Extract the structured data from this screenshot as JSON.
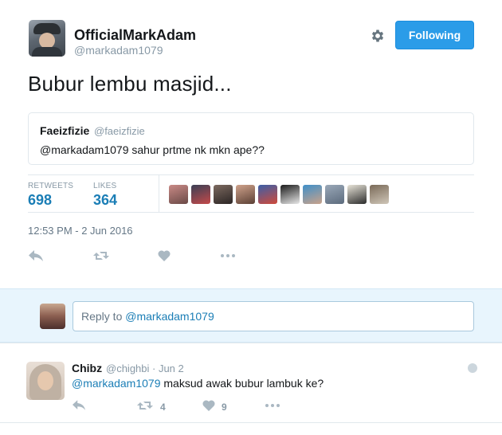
{
  "author": {
    "display_name": "OfficialMarkAdam",
    "username": "@markadam1079"
  },
  "follow_button_label": "Following",
  "tweet": {
    "text": "Bubur lembu masjid...",
    "timestamp": "12:53 PM - 2 Jun 2016"
  },
  "quoted_tweet": {
    "name": "Faeizfizie",
    "handle": "@faeizfizie",
    "text": "@markadam1079 sahur prtme nk mkn ape??"
  },
  "stats": {
    "retweets_label": "RETWEETS",
    "retweets_value": "698",
    "likes_label": "LIKES",
    "likes_value": "364"
  },
  "likers": [
    {
      "name": "liker-avatar-1",
      "colors": [
        "#c98a86",
        "#6b4a47"
      ]
    },
    {
      "name": "liker-avatar-2",
      "colors": [
        "#3a3f55",
        "#c44a4a"
      ]
    },
    {
      "name": "liker-avatar-3",
      "colors": [
        "#7d6a60",
        "#2b2524"
      ]
    },
    {
      "name": "liker-avatar-4",
      "colors": [
        "#d0a38c",
        "#5b4035"
      ]
    },
    {
      "name": "liker-avatar-5",
      "colors": [
        "#3b5fa8",
        "#d04a3a"
      ]
    },
    {
      "name": "liker-avatar-6",
      "colors": [
        "#1a1a1a",
        "#e8e8e8"
      ]
    },
    {
      "name": "liker-avatar-7",
      "colors": [
        "#3f8fc9",
        "#c9a28a"
      ]
    },
    {
      "name": "liker-avatar-8",
      "colors": [
        "#9aa8b8",
        "#5c6b7d"
      ]
    },
    {
      "name": "liker-avatar-9",
      "colors": [
        "#e8e4d8",
        "#2b2b2b"
      ]
    },
    {
      "name": "liker-avatar-10",
      "colors": [
        "#7a6a58",
        "#cfc6b8"
      ]
    }
  ],
  "reply_composer": {
    "prefix": "Reply to ",
    "mention": "@markadam1079"
  },
  "reply": {
    "name": "Chibz",
    "meta": "@chighbi · Jun 2",
    "mention": "@markadam1079",
    "text": " maksud awak bubur lambuk ke?",
    "retweet_count": "4",
    "like_count": "9"
  },
  "colors": {
    "accent": "#2b9ce8",
    "link": "#1b7eb6",
    "muted": "#8899a6",
    "reply_bg": "#e8f5fd"
  },
  "icons": [
    "gear-icon",
    "reply-icon",
    "retweet-icon",
    "heart-icon",
    "more-icon",
    "globe-icon"
  ]
}
